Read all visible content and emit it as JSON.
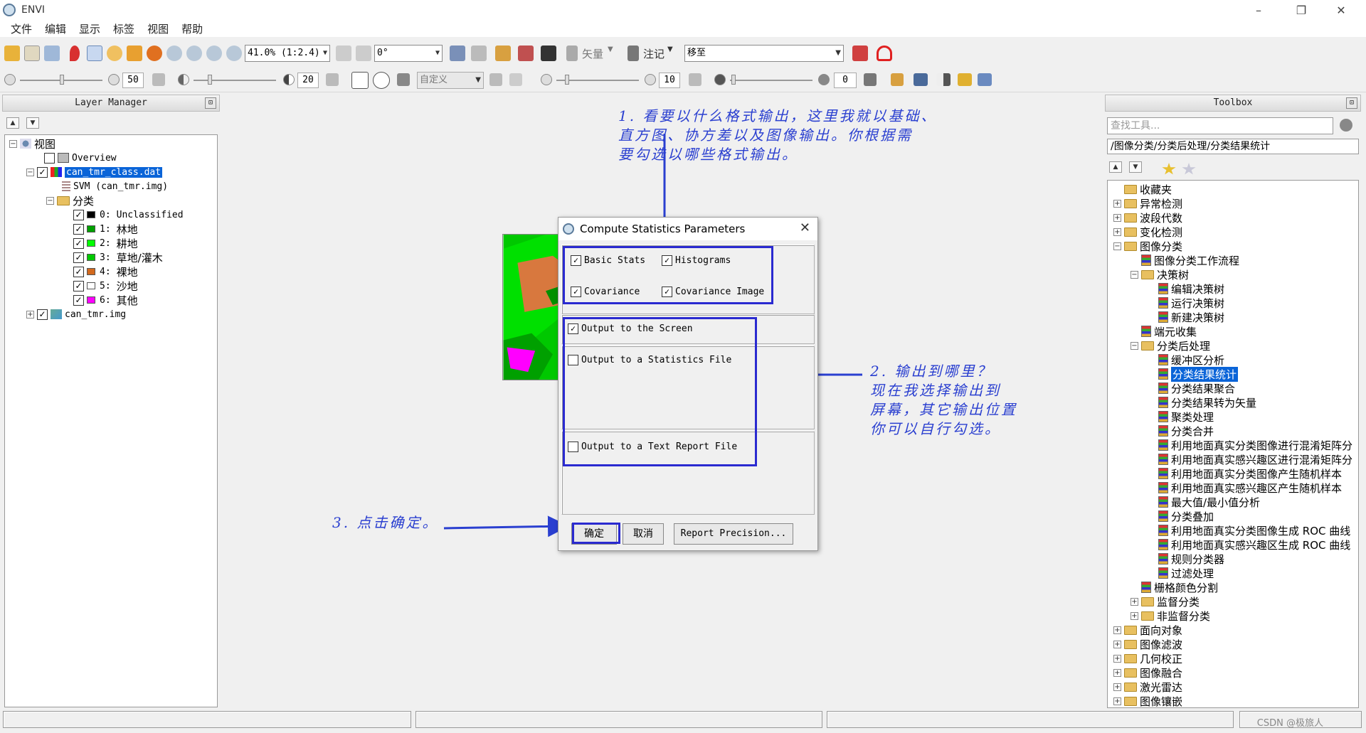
{
  "app": {
    "title": "ENVI",
    "window_controls": {
      "minimize": "–",
      "maximize": "❐",
      "close": "✕"
    }
  },
  "menu": [
    "文件",
    "编辑",
    "显示",
    "标签",
    "视图",
    "帮助"
  ],
  "toolbar": {
    "zoom_value": "41.0% (1:2.4)",
    "rotation_value": "0°",
    "vector_label": "矢量",
    "annotation_label": "注记",
    "goto_value": "移至",
    "stretch_value": "自定义",
    "brightness": "50",
    "contrast": "20",
    "sharpen": "10",
    "transparency": "0"
  },
  "layer_manager": {
    "title": "Layer Manager",
    "root": "视图",
    "items": [
      {
        "label": "Overview"
      },
      {
        "label": "can_tmr_class.dat"
      },
      {
        "label": "SVM (can_tmr.img)"
      },
      {
        "label": "分类"
      },
      {
        "label": "can_tmr.img"
      }
    ],
    "classes": [
      {
        "num": "0:",
        "name": "Unclassified",
        "color": "#000000"
      },
      {
        "num": "1:",
        "name": "林地",
        "color": "#00a000"
      },
      {
        "num": "2:",
        "name": "耕地",
        "color": "#00ff00"
      },
      {
        "num": "3:",
        "name": "草地/灌木",
        "color": "#00c800"
      },
      {
        "num": "4:",
        "name": "裸地",
        "color": "#d2691e"
      },
      {
        "num": "5:",
        "name": "沙地",
        "color": "#ffffff"
      },
      {
        "num": "6:",
        "name": "其他",
        "color": "#ff00ff"
      }
    ]
  },
  "dialog": {
    "title": "Compute Statistics Parameters",
    "options": {
      "basic_stats": "Basic Stats",
      "histograms": "Histograms",
      "covariance": "Covariance",
      "covariance_image": "Covariance Image"
    },
    "outputs": {
      "screen": "Output to the Screen",
      "stats_file": "Output to a Statistics File",
      "text_report": "Output to a Text Report File"
    },
    "buttons": {
      "ok": "确定",
      "cancel": "取消",
      "precision": "Report Precision..."
    }
  },
  "annotations": {
    "note1": [
      "1. 看要以什么格式输出，这里我就以基础、",
      "直方图、协方差以及图像输出。你根据需",
      "要勾选以哪些格式输出。"
    ],
    "note2": [
      "2. 输出到哪里？",
      "现在我选择输出到",
      "屏幕，其它输出位置",
      "你可以自行勾选。"
    ],
    "note3": "3. 点击确定。",
    "color": "#2a3fd0"
  },
  "toolbox": {
    "title": "Toolbox",
    "search_placeholder": "查找工具...",
    "path": "/图像分类/分类后处理/分类结果统计",
    "tree": [
      {
        "label": "收藏夹",
        "type": "folder",
        "level": 0,
        "exp": ""
      },
      {
        "label": "异常检测",
        "type": "folder",
        "level": 0,
        "exp": "+"
      },
      {
        "label": "波段代数",
        "type": "folder",
        "level": 0,
        "exp": "+"
      },
      {
        "label": "变化检测",
        "type": "folder",
        "level": 0,
        "exp": "+"
      },
      {
        "label": "图像分类",
        "type": "folder",
        "level": 0,
        "exp": "−"
      },
      {
        "label": "图像分类工作流程",
        "type": "tool",
        "level": 1,
        "exp": ""
      },
      {
        "label": "决策树",
        "type": "folder",
        "level": 1,
        "exp": "−"
      },
      {
        "label": "编辑决策树",
        "type": "tool",
        "level": 2,
        "exp": ""
      },
      {
        "label": "运行决策树",
        "type": "tool",
        "level": 2,
        "exp": ""
      },
      {
        "label": "新建决策树",
        "type": "tool",
        "level": 2,
        "exp": ""
      },
      {
        "label": "端元收集",
        "type": "tool",
        "level": 1,
        "exp": ""
      },
      {
        "label": "分类后处理",
        "type": "folder",
        "level": 1,
        "exp": "−"
      },
      {
        "label": "缓冲区分析",
        "type": "tool",
        "level": 2,
        "exp": ""
      },
      {
        "label": "分类结果统计",
        "type": "tool",
        "level": 2,
        "exp": "",
        "selected": true
      },
      {
        "label": "分类结果聚合",
        "type": "tool",
        "level": 2,
        "exp": ""
      },
      {
        "label": "分类结果转为矢量",
        "type": "tool",
        "level": 2,
        "exp": ""
      },
      {
        "label": "聚类处理",
        "type": "tool",
        "level": 2,
        "exp": ""
      },
      {
        "label": "分类合并",
        "type": "tool",
        "level": 2,
        "exp": ""
      },
      {
        "label": "利用地面真实分类图像进行混淆矩阵分",
        "type": "tool",
        "level": 2,
        "exp": ""
      },
      {
        "label": "利用地面真实感兴趣区进行混淆矩阵分",
        "type": "tool",
        "level": 2,
        "exp": ""
      },
      {
        "label": "利用地面真实分类图像产生随机样本",
        "type": "tool",
        "level": 2,
        "exp": ""
      },
      {
        "label": "利用地面真实感兴趣区产生随机样本",
        "type": "tool",
        "level": 2,
        "exp": ""
      },
      {
        "label": "最大值/最小值分析",
        "type": "tool",
        "level": 2,
        "exp": ""
      },
      {
        "label": "分类叠加",
        "type": "tool",
        "level": 2,
        "exp": ""
      },
      {
        "label": "利用地面真实分类图像生成 ROC 曲线",
        "type": "tool",
        "level": 2,
        "exp": ""
      },
      {
        "label": "利用地面真实感兴趣区生成 ROC 曲线",
        "type": "tool",
        "level": 2,
        "exp": ""
      },
      {
        "label": "规则分类器",
        "type": "tool",
        "level": 2,
        "exp": ""
      },
      {
        "label": "过滤处理",
        "type": "tool",
        "level": 2,
        "exp": ""
      },
      {
        "label": "栅格颜色分割",
        "type": "tool",
        "level": 1,
        "exp": ""
      },
      {
        "label": "监督分类",
        "type": "folder",
        "level": 1,
        "exp": "+"
      },
      {
        "label": "非监督分类",
        "type": "folder",
        "level": 1,
        "exp": "+"
      },
      {
        "label": "面向对象",
        "type": "folder",
        "level": 0,
        "exp": "+"
      },
      {
        "label": "图像滤波",
        "type": "folder",
        "level": 0,
        "exp": "+"
      },
      {
        "label": "几何校正",
        "type": "folder",
        "level": 0,
        "exp": "+"
      },
      {
        "label": "图像融合",
        "type": "folder",
        "level": 0,
        "exp": "+"
      },
      {
        "label": "激光雷达",
        "type": "folder",
        "level": 0,
        "exp": "+"
      },
      {
        "label": "图像镶嵌",
        "type": "folder",
        "level": 0,
        "exp": "+"
      }
    ]
  },
  "status": {
    "watermark": "CSDN @极旅人"
  }
}
